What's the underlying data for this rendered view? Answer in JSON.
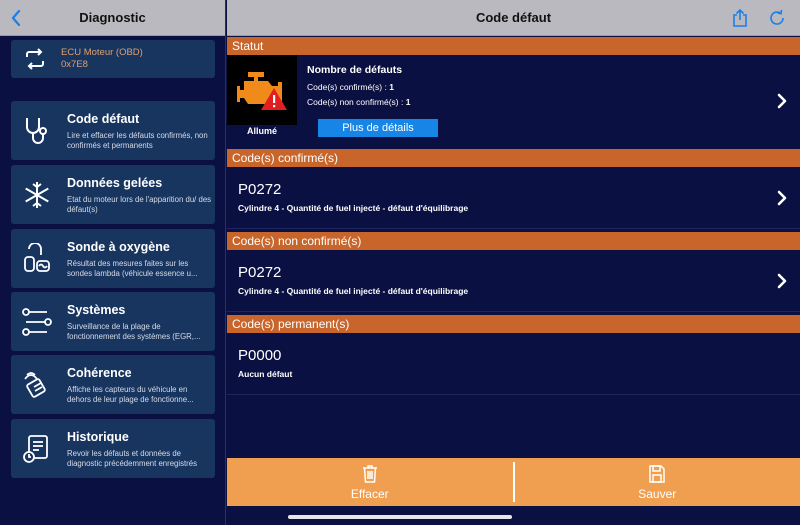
{
  "sidebar": {
    "title": "Diagnostic",
    "ecu": {
      "line1": "ECU Moteur (OBD)",
      "line2": "0x7E8"
    },
    "items": [
      {
        "title": "Code défaut",
        "desc": "Lire et effacer les défauts confirmés, non confirmés et permanents",
        "icon": "stethoscope-icon"
      },
      {
        "title": "Données gelées",
        "desc": "Etat du moteur lors de l'apparition du/ des défaut(s)",
        "icon": "snowflake-icon"
      },
      {
        "title": "Sonde à oxygène",
        "desc": "Résultat des mesures faites sur les sondes lambda (véhicule essence u...",
        "icon": "oxygen-sensor-icon"
      },
      {
        "title": "Systèmes",
        "desc": "Surveillance de la plage de fonctionnement des systèmes (EGR,...",
        "icon": "systems-icon"
      },
      {
        "title": "Cohérence",
        "desc": "Affiche les capteurs du véhicule en dehors de leur plage de fonctionne...",
        "icon": "sensor-icon"
      },
      {
        "title": "Historique",
        "desc": "Revoir les défauts et données de diagnostic précédemment enregistrés",
        "icon": "history-icon"
      }
    ]
  },
  "main": {
    "title": "Code défaut",
    "status_section": "Statut",
    "status": {
      "title": "Nombre de défauts",
      "confirmed_label": "Code(s) confirmé(s) : ",
      "confirmed_value": "1",
      "unconfirmed_label": "Code(s) non confirmé(s) : ",
      "unconfirmed_value": "1",
      "lamp_state": "Allumé",
      "details_button": "Plus de détails"
    },
    "sections": [
      {
        "header": "Code(s) confirmé(s)",
        "code": "P0272",
        "desc": "Cylindre 4 - Quantité de fuel injecté - défaut d'équilibrage"
      },
      {
        "header": "Code(s) non confirmé(s)",
        "code": "P0272",
        "desc": "Cylindre 4 - Quantité de fuel injecté - défaut d'équilibrage"
      },
      {
        "header": "Code(s) permanent(s)",
        "code": "P0000",
        "desc": "Aucun défaut"
      }
    ],
    "actions": {
      "clear": "Effacer",
      "save": "Sauver"
    }
  },
  "colors": {
    "accent": "#c8652b",
    "bar": "#ef9f4f",
    "button": "#1685e5",
    "card": "#183560",
    "bg": "#0a1142"
  }
}
